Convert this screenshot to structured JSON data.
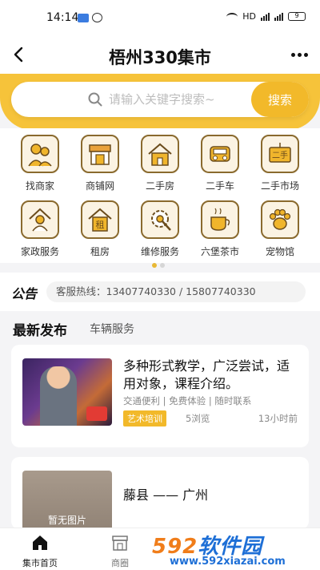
{
  "status_bar": {
    "time": "14:14",
    "network": "HD",
    "battery": "9"
  },
  "navbar": {
    "title": "梧州330集市"
  },
  "search": {
    "placeholder": "请输入关键字搜索~",
    "button": "搜索"
  },
  "categories": [
    {
      "label": "找商家",
      "icon": "merchant-icon"
    },
    {
      "label": "商铺网",
      "icon": "shop-icon"
    },
    {
      "label": "二手房",
      "icon": "house-icon"
    },
    {
      "label": "二手车",
      "icon": "car-icon"
    },
    {
      "label": "二手市场",
      "icon": "secondhand-icon"
    },
    {
      "label": "家政服务",
      "icon": "housekeeping-icon"
    },
    {
      "label": "租房",
      "icon": "rent-icon"
    },
    {
      "label": "维修服务",
      "icon": "repair-icon"
    },
    {
      "label": "六堡茶市",
      "icon": "tea-icon"
    },
    {
      "label": "宠物馆",
      "icon": "pet-icon"
    }
  ],
  "rent_char": "租",
  "secondhand_char": "二手",
  "notice": {
    "logo": "公告",
    "text": "客服热线：13407740330 / 15807740330"
  },
  "tabs": {
    "active": "最新发布",
    "other": "车辆服务"
  },
  "listings": [
    {
      "title": "多种形式教学，广泛尝试，适用对象，课程介绍。",
      "tags": "交通便利 | 免费体验 | 随时联系",
      "category": "艺术培训",
      "views": "5浏览",
      "time": "13小时前"
    },
    {
      "title": "藤县 —— 广州",
      "no_image": "暂无图片"
    }
  ],
  "bottom_nav": {
    "home": "集市首页",
    "shops": "商圈"
  },
  "watermark": {
    "brand_a": "592",
    "brand_b": "软件园",
    "url": "www.592xiazai.com"
  },
  "colors": {
    "accent": "#f2b92a",
    "band": "#f6c33a",
    "icon_border": "#8a6a2e"
  }
}
